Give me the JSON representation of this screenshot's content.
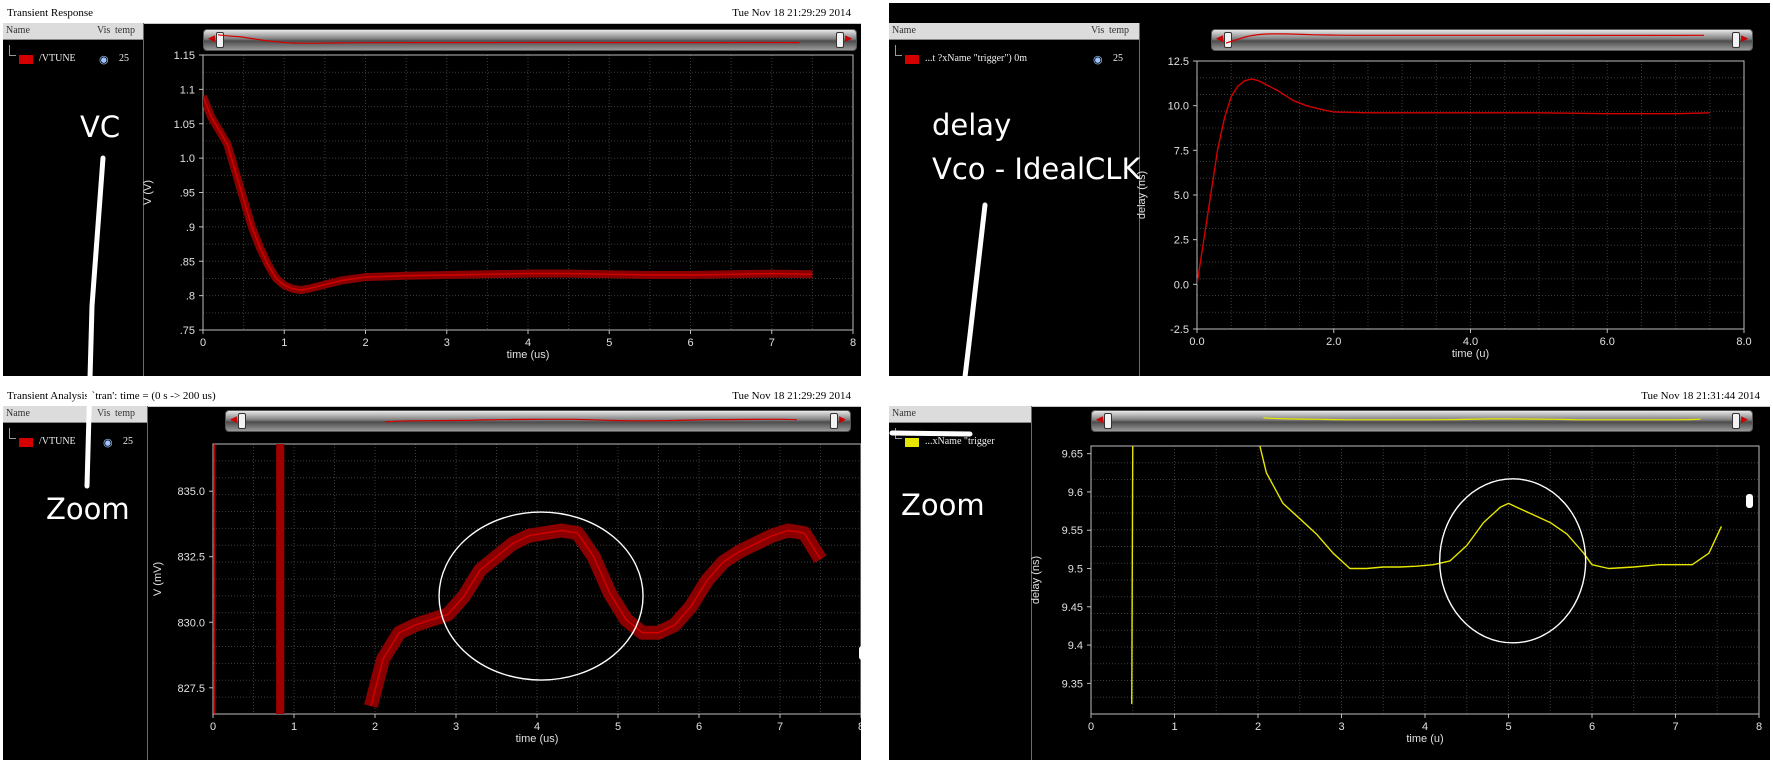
{
  "panels": [
    {
      "id": "top-left",
      "header_title": "Transient Response",
      "header_date": "Tue Nov 18 21:29:29 2014",
      "legend": {
        "col_name": "Name",
        "col_vis": "Vis",
        "col_temp": "temp",
        "signal": "/VTUNE",
        "signal_color": "#d40000",
        "temp_value": "25"
      },
      "annotations": [
        "VC"
      ]
    },
    {
      "id": "top-right",
      "header_title": "",
      "header_date": "",
      "legend": {
        "col_name": "Name",
        "col_vis": "Vis",
        "col_temp": "temp",
        "signal": "...t ?xName \"trigger\") 0m",
        "signal_color": "#d40000",
        "temp_value": "25"
      },
      "annotations": [
        "delay",
        "Vco - IdealCLK"
      ]
    },
    {
      "id": "bottom-left",
      "header_title": "Transient Analysis `tran': time = (0 s -> 200 us)",
      "header_date": "Tue Nov 18 21:29:29 2014",
      "legend": {
        "col_name": "Name",
        "col_vis": "Vis",
        "col_temp": "temp",
        "signal": "/VTUNE",
        "signal_color": "#d40000",
        "temp_value": "25"
      },
      "annotations": [
        "Zoom"
      ]
    },
    {
      "id": "bottom-right",
      "header_title": "",
      "header_date": "Tue Nov 18 21:31:44 2014",
      "legend": {
        "col_name": "Name",
        "col_vis": "",
        "col_temp": "",
        "signal": "...xName \"trigger",
        "signal_color": "#e6e600",
        "temp_value": ""
      },
      "annotations": [
        "Zoom"
      ]
    }
  ],
  "chart_data": [
    {
      "type": "line",
      "xlabel": "time (us)",
      "ylabel": "V (V)",
      "xlim": [
        0,
        8
      ],
      "ylim": [
        0.75,
        1.15
      ],
      "x_ticks": [
        "0",
        "1",
        "2",
        "3",
        "4",
        "5",
        "6",
        "7",
        "8"
      ],
      "y_ticks": [
        ".75",
        ".8",
        ".85",
        ".9",
        ".95",
        "1.0",
        "1.05",
        "1.1",
        "1.15"
      ],
      "grid": true,
      "series": [
        {
          "name": "/VTUNE",
          "color": "#d40000",
          "x": [
            0,
            0.1,
            0.2,
            0.3,
            0.4,
            0.5,
            0.6,
            0.7,
            0.8,
            0.9,
            1.0,
            1.1,
            1.2,
            1.3,
            1.5,
            1.7,
            2.0,
            2.5,
            3.0,
            3.5,
            4.0,
            4.5,
            5.0,
            5.5,
            6.0,
            6.5,
            7.0,
            7.5
          ],
          "y": [
            1.09,
            1.06,
            1.04,
            1.02,
            0.98,
            0.94,
            0.9,
            0.87,
            0.845,
            0.825,
            0.815,
            0.81,
            0.808,
            0.81,
            0.816,
            0.822,
            0.827,
            0.829,
            0.83,
            0.831,
            0.832,
            0.832,
            0.831,
            0.83,
            0.83,
            0.831,
            0.832,
            0.831
          ]
        }
      ]
    },
    {
      "type": "line",
      "xlabel": "time (u)",
      "ylabel": "delay (ns)",
      "xlim": [
        0,
        8
      ],
      "ylim": [
        -2.5,
        12.5
      ],
      "x_ticks": [
        "0.0",
        "2.0",
        "4.0",
        "6.0",
        "8.0"
      ],
      "y_ticks": [
        "-2.5",
        "0.0",
        "2.5",
        "5.0",
        "7.5",
        "10.0",
        "12.5"
      ],
      "grid": true,
      "series": [
        {
          "name": "...t ?xName \"trigger\") 0m",
          "color": "#d40000",
          "x": [
            0,
            0.1,
            0.2,
            0.3,
            0.4,
            0.5,
            0.6,
            0.7,
            0.8,
            0.9,
            1.0,
            1.2,
            1.4,
            1.6,
            1.8,
            2.0,
            2.5,
            3.0,
            4.0,
            5.0,
            6.0,
            7.0,
            7.5
          ],
          "y": [
            0.0,
            2.5,
            5.0,
            7.5,
            9.3,
            10.5,
            11.1,
            11.4,
            11.5,
            11.4,
            11.2,
            10.8,
            10.3,
            10.0,
            9.8,
            9.65,
            9.6,
            9.6,
            9.6,
            9.6,
            9.55,
            9.55,
            9.6
          ]
        }
      ]
    },
    {
      "type": "line",
      "xlabel": "time (us)",
      "ylabel": "V (mV)",
      "xlim": [
        0,
        8
      ],
      "ylim": [
        826.5,
        836.8
      ],
      "x_ticks": [
        "0",
        "1",
        "2",
        "3",
        "4",
        "5",
        "6",
        "7",
        "8"
      ],
      "y_ticks": [
        "827.5",
        "830.0",
        "832.5",
        "835.0"
      ],
      "grid": true,
      "series": [
        {
          "name": "/VTUNE",
          "color": "#d40000",
          "x": [
            1.95,
            2.1,
            2.3,
            2.5,
            2.7,
            2.9,
            3.1,
            3.3,
            3.5,
            3.7,
            3.9,
            4.1,
            4.3,
            4.5,
            4.7,
            4.9,
            5.1,
            5.3,
            5.5,
            5.7,
            5.9,
            6.1,
            6.3,
            6.5,
            6.7,
            6.9,
            7.1,
            7.3,
            7.5
          ],
          "y": [
            826.8,
            828.6,
            829.6,
            829.9,
            830.1,
            830.3,
            831.0,
            832.0,
            832.5,
            833.0,
            833.3,
            833.4,
            833.5,
            833.4,
            832.5,
            831.1,
            830.1,
            829.6,
            829.6,
            829.9,
            830.6,
            831.6,
            832.3,
            832.7,
            833.0,
            833.3,
            833.5,
            833.4,
            832.4
          ]
        }
      ],
      "annotations": [
        "Zoom"
      ]
    },
    {
      "type": "line",
      "xlabel": "time (u)",
      "ylabel": "delay (ns)",
      "xlim": [
        0,
        8
      ],
      "ylim": [
        9.31,
        9.66
      ],
      "x_ticks": [
        "0",
        "1",
        "2",
        "3",
        "4",
        "5",
        "6",
        "7",
        "8"
      ],
      "y_ticks": [
        "9.35",
        "9.4",
        "9.45",
        "9.5",
        "9.55",
        "9.6",
        "9.65"
      ],
      "grid": true,
      "series": [
        {
          "name": "...xName \"trigger",
          "color": "#e6e600",
          "x": [
            2.0,
            2.1,
            2.3,
            2.5,
            2.7,
            2.9,
            3.1,
            3.3,
            3.5,
            3.7,
            3.9,
            4.1,
            4.3,
            4.5,
            4.7,
            4.9,
            5.0,
            5.1,
            5.3,
            5.5,
            5.7,
            5.9,
            6.0,
            6.2,
            6.5,
            6.8,
            7.0,
            7.2,
            7.4,
            7.55
          ],
          "y": [
            9.67,
            9.625,
            9.585,
            9.565,
            9.545,
            9.52,
            9.5,
            9.5,
            9.502,
            9.502,
            9.503,
            9.505,
            9.51,
            9.53,
            9.56,
            9.58,
            9.585,
            9.58,
            9.57,
            9.56,
            9.545,
            9.52,
            9.505,
            9.5,
            9.502,
            9.505,
            9.505,
            9.505,
            9.52,
            9.555
          ]
        }
      ],
      "annotations": [
        "Zoom"
      ]
    }
  ]
}
